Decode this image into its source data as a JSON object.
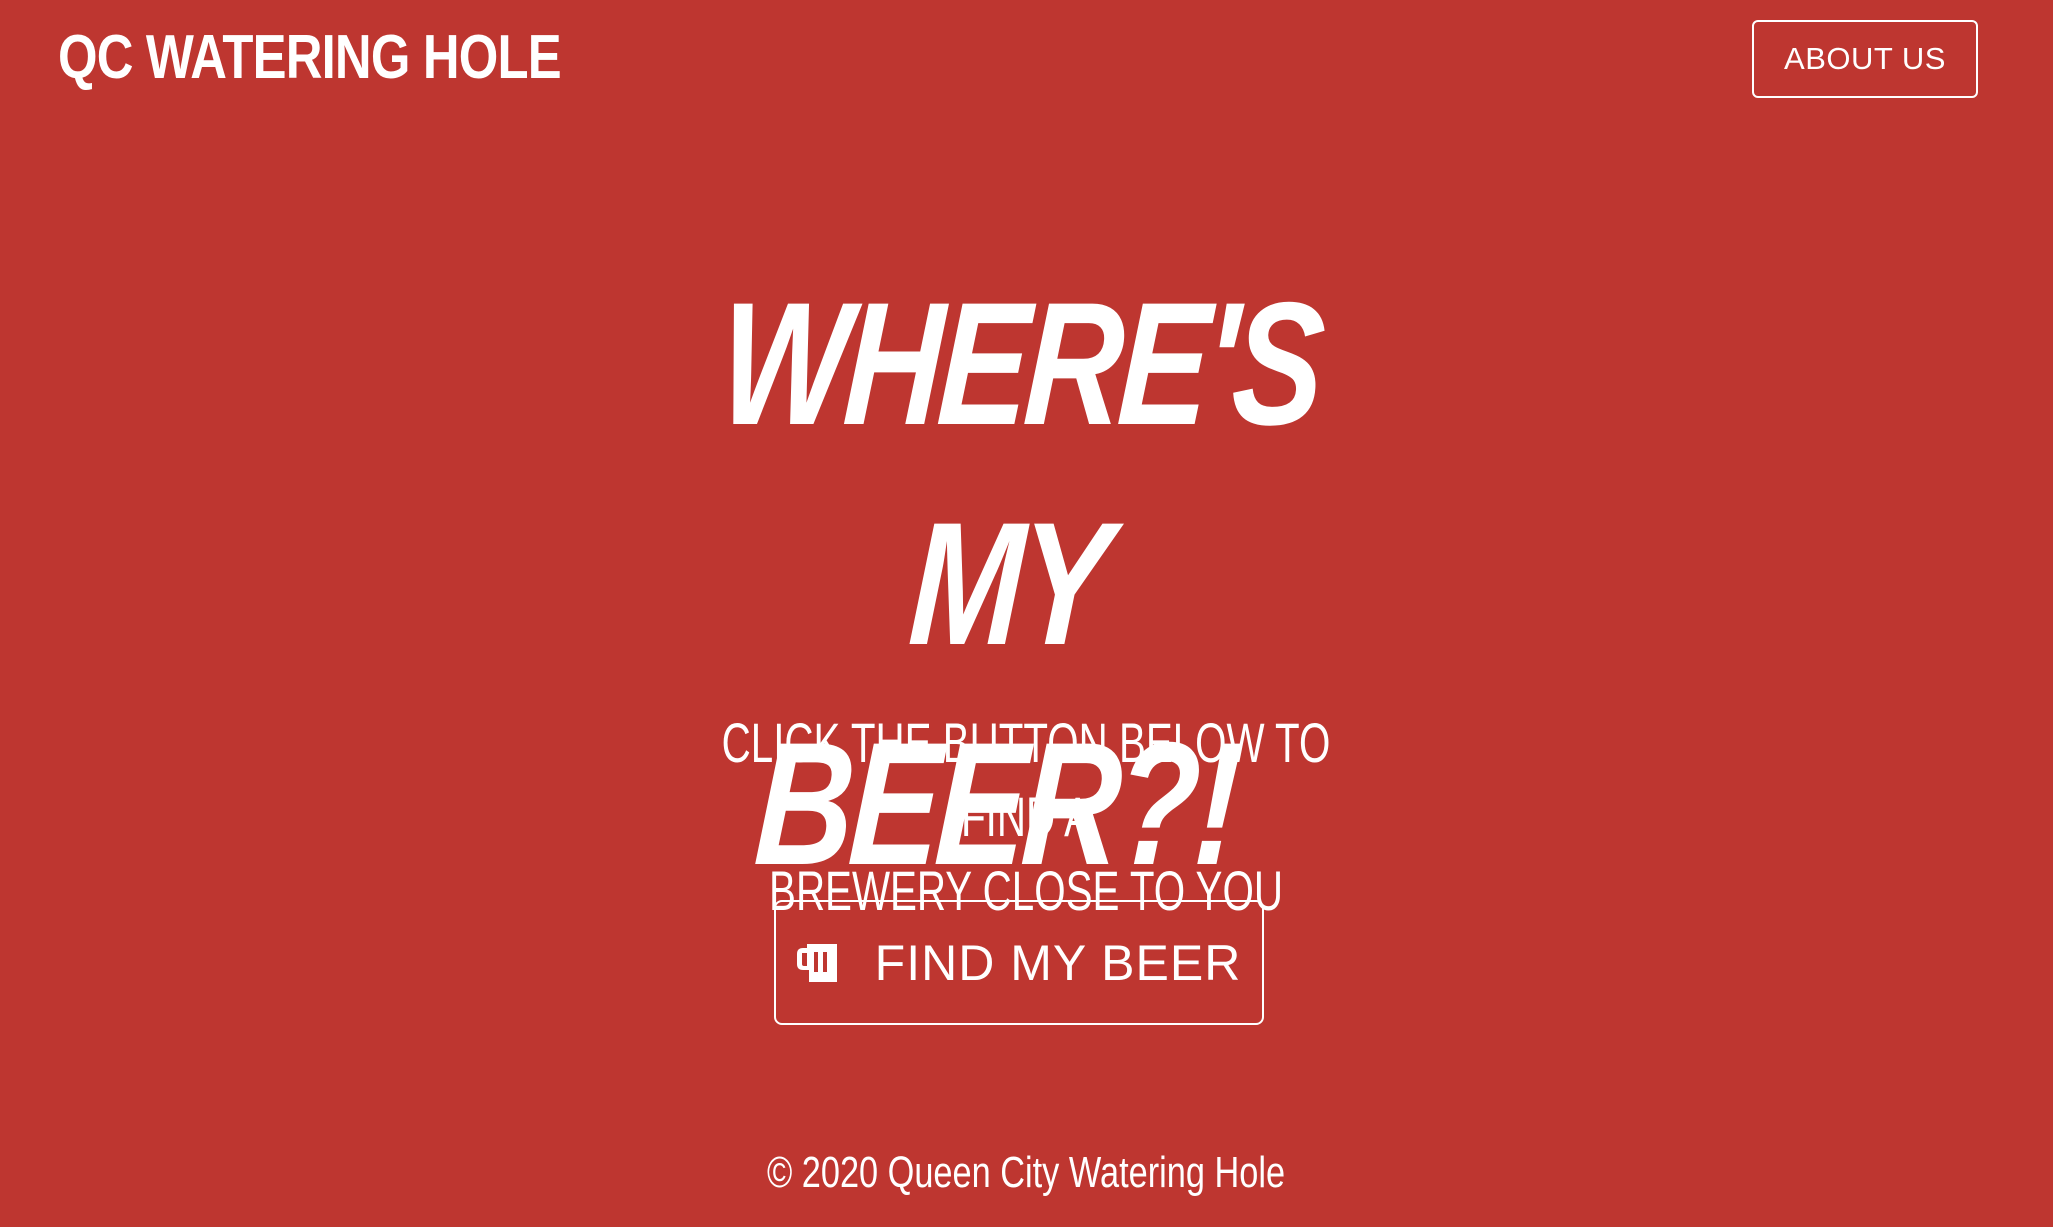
{
  "navbar": {
    "brand": "QC WATERING HOLE",
    "about_label": "ABOUT US"
  },
  "hero": {
    "title_line1": "WHERE'S MY",
    "title_line2": "BEER?!",
    "subtitle_line1": "CLICK THE BUTTON BELOW TO FIND A",
    "subtitle_line2": "BREWERY CLOSE TO YOU",
    "button_label": "FIND MY BEER",
    "button_icon": "beer-mug-icon"
  },
  "footer": {
    "text": "© 2020 Queen City Watering Hole"
  },
  "colors": {
    "background": "#be3630",
    "foreground": "#ffffff"
  }
}
